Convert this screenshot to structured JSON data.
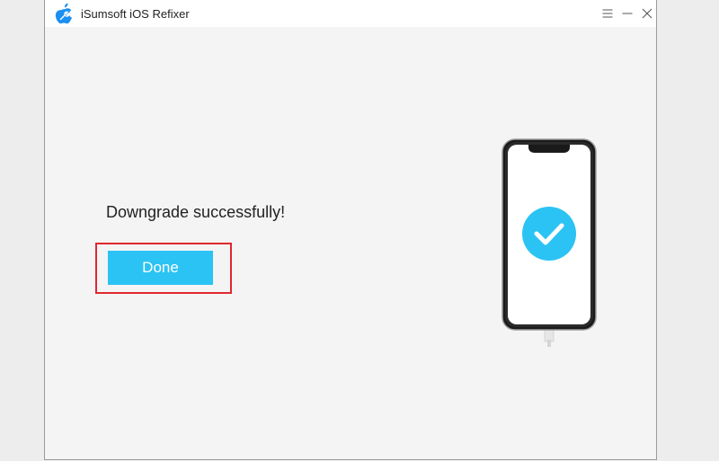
{
  "window": {
    "title": "iSumsoft iOS Refixer",
    "controls": {
      "menu_icon": "menu-icon",
      "minimize_icon": "minimize-icon",
      "close_icon": "close-icon"
    }
  },
  "main": {
    "status_message": "Downgrade successfully!",
    "done_label": "Done"
  },
  "colors": {
    "accent": "#2bc3f3",
    "highlight_border": "#e0282e",
    "background": "#f4f4f4",
    "titlebar": "#ffffff",
    "app_logo": "#1c8ff0"
  },
  "icons": {
    "app_logo": "apple-wrench-logo-icon",
    "device": "iphone-check-icon"
  }
}
